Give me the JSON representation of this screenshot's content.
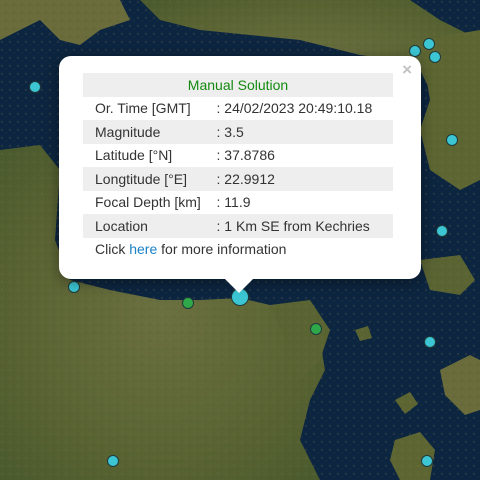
{
  "map": {
    "markers": [
      {
        "name": "event-marker",
        "color": "#3cc6d4"
      },
      {
        "name": "event-marker",
        "color": "#3cc6d4"
      },
      {
        "name": "event-marker",
        "color": "#3cc6d4"
      },
      {
        "name": "event-marker",
        "color": "#3cc6d4"
      },
      {
        "name": "event-marker",
        "color": "#3cc6d4"
      },
      {
        "name": "event-marker",
        "color": "#3cc6d4"
      },
      {
        "name": "event-marker",
        "color": "#3cc6d4"
      },
      {
        "name": "event-marker",
        "color": "#3cc6d4"
      },
      {
        "name": "event-marker",
        "color": "#3cc6d4"
      },
      {
        "name": "event-marker",
        "color": "#3cc6d4"
      },
      {
        "name": "event-marker",
        "color": "#3cc6d4"
      },
      {
        "name": "event-marker",
        "color": "#2fa84a"
      },
      {
        "name": "event-marker",
        "color": "#2fa84a"
      },
      {
        "name": "selected-event-marker",
        "color": "#3cc6d4"
      }
    ]
  },
  "popup": {
    "title": "Manual Solution",
    "rows": [
      {
        "label": "Or. Time [GMT]",
        "value": ": 24/02/2023 20:49:10.18"
      },
      {
        "label": "Magnitude",
        "value": ": 3.5"
      },
      {
        "label": "Latitude [°N]",
        "value": ": 37.8786"
      },
      {
        "label": "Longtitude [°E]",
        "value": ": 22.9912"
      },
      {
        "label": "Focal Depth [km]",
        "value": ": 11.9"
      },
      {
        "label": "Location",
        "value": ": 1 Km SE from Kechries"
      }
    ],
    "footer": {
      "prefix": "Click",
      "link": "here",
      "suffix": "for more information"
    },
    "close_symbol": "×"
  },
  "colors": {
    "sea": "#0c2540",
    "land": "#5f6a36",
    "title_green": "#138a0f",
    "link_blue": "#1a82c4",
    "marker_cyan": "#3cc6d4",
    "marker_green": "#2fa84a"
  }
}
